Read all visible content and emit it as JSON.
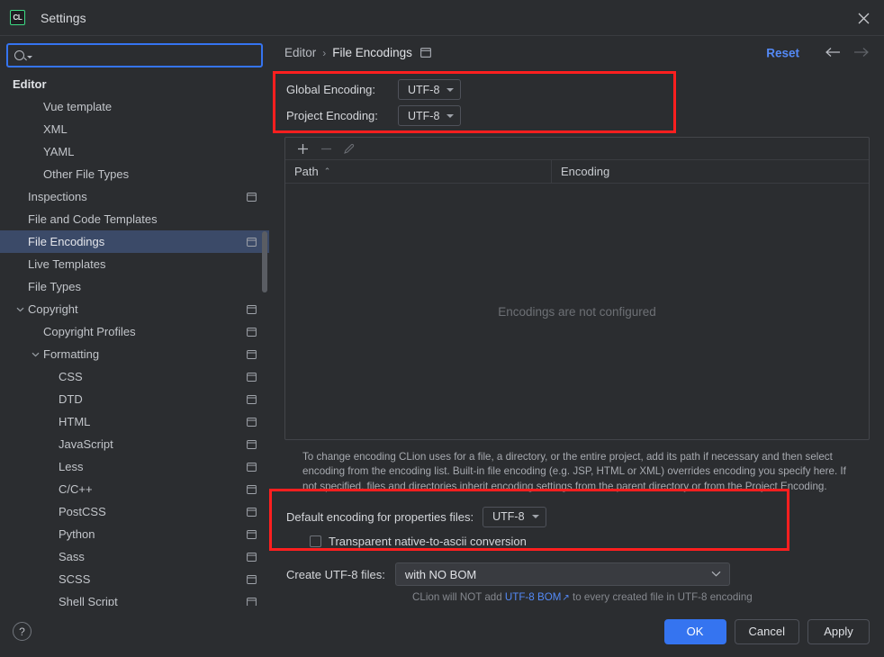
{
  "window": {
    "title": "Settings",
    "logo_text": "CL",
    "close_icon": "close-icon"
  },
  "search": {
    "value": "",
    "placeholder": ""
  },
  "sidebar": {
    "items": [
      {
        "label": "Editor",
        "depth": 0,
        "bold": true,
        "twisty": "",
        "project_icon": false,
        "selected": false
      },
      {
        "label": "Vue template",
        "depth": 2,
        "bold": false,
        "twisty": "",
        "project_icon": false,
        "selected": false
      },
      {
        "label": "XML",
        "depth": 2,
        "bold": false,
        "twisty": "",
        "project_icon": false,
        "selected": false
      },
      {
        "label": "YAML",
        "depth": 2,
        "bold": false,
        "twisty": "",
        "project_icon": false,
        "selected": false
      },
      {
        "label": "Other File Types",
        "depth": 2,
        "bold": false,
        "twisty": "",
        "project_icon": false,
        "selected": false
      },
      {
        "label": "Inspections",
        "depth": 1,
        "bold": false,
        "twisty": "",
        "project_icon": true,
        "selected": false
      },
      {
        "label": "File and Code Templates",
        "depth": 1,
        "bold": false,
        "twisty": "",
        "project_icon": false,
        "selected": false
      },
      {
        "label": "File Encodings",
        "depth": 1,
        "bold": false,
        "twisty": "",
        "project_icon": true,
        "selected": true
      },
      {
        "label": "Live Templates",
        "depth": 1,
        "bold": false,
        "twisty": "",
        "project_icon": false,
        "selected": false
      },
      {
        "label": "File Types",
        "depth": 1,
        "bold": false,
        "twisty": "",
        "project_icon": false,
        "selected": false
      },
      {
        "label": "Copyright",
        "depth": 1,
        "bold": false,
        "twisty": "expanded",
        "project_icon": true,
        "selected": false
      },
      {
        "label": "Copyright Profiles",
        "depth": 2,
        "bold": false,
        "twisty": "",
        "project_icon": true,
        "selected": false
      },
      {
        "label": "Formatting",
        "depth": 2,
        "bold": false,
        "twisty": "expanded",
        "project_icon": true,
        "selected": false
      },
      {
        "label": "CSS",
        "depth": 3,
        "bold": false,
        "twisty": "",
        "project_icon": true,
        "selected": false
      },
      {
        "label": "DTD",
        "depth": 3,
        "bold": false,
        "twisty": "",
        "project_icon": true,
        "selected": false
      },
      {
        "label": "HTML",
        "depth": 3,
        "bold": false,
        "twisty": "",
        "project_icon": true,
        "selected": false
      },
      {
        "label": "JavaScript",
        "depth": 3,
        "bold": false,
        "twisty": "",
        "project_icon": true,
        "selected": false
      },
      {
        "label": "Less",
        "depth": 3,
        "bold": false,
        "twisty": "",
        "project_icon": true,
        "selected": false
      },
      {
        "label": "C/C++",
        "depth": 3,
        "bold": false,
        "twisty": "",
        "project_icon": true,
        "selected": false
      },
      {
        "label": "PostCSS",
        "depth": 3,
        "bold": false,
        "twisty": "",
        "project_icon": true,
        "selected": false
      },
      {
        "label": "Python",
        "depth": 3,
        "bold": false,
        "twisty": "",
        "project_icon": true,
        "selected": false
      },
      {
        "label": "Sass",
        "depth": 3,
        "bold": false,
        "twisty": "",
        "project_icon": true,
        "selected": false
      },
      {
        "label": "SCSS",
        "depth": 3,
        "bold": false,
        "twisty": "",
        "project_icon": true,
        "selected": false
      },
      {
        "label": "Shell Script",
        "depth": 3,
        "bold": false,
        "twisty": "",
        "project_icon": true,
        "selected": false
      }
    ]
  },
  "breadcrumb": {
    "parent": "Editor",
    "separator": "›",
    "current": "File Encodings",
    "icon": "project-settings-icon"
  },
  "header": {
    "reset_label": "Reset",
    "back_icon": "arrow-left-icon",
    "forward_icon": "arrow-right-icon"
  },
  "encodings": {
    "global": {
      "label": "Global Encoding:",
      "value": "UTF-8"
    },
    "project": {
      "label": "Project Encoding:",
      "value": "UTF-8"
    }
  },
  "table": {
    "toolbar": {
      "add_icon": "plus-icon",
      "remove_icon": "minus-icon",
      "edit_icon": "pencil-icon"
    },
    "columns": [
      {
        "label": "Path",
        "sort": "⌃"
      },
      {
        "label": "Encoding",
        "sort": ""
      }
    ],
    "rows": [],
    "empty_message": "Encodings are not configured"
  },
  "help_text": "To change encoding CLion uses for a file, a directory, or the entire project, add its path if necessary and then select encoding from the encoding list. Built-in file encoding (e.g. JSP, HTML or XML) overrides encoding you specify here. If not specified, files and directories inherit encoding settings from the parent directory or from the Project Encoding.",
  "properties": {
    "default_encoding_label": "Default encoding for properties files:",
    "default_encoding_value": "UTF-8",
    "transparent_label": "Transparent native-to-ascii conversion",
    "transparent_checked": false
  },
  "create_utf8": {
    "label": "Create UTF-8 files:",
    "value": "with NO BOM",
    "note_prefix": "CLion will NOT add ",
    "note_link": "UTF-8 BOM",
    "note_ext_icon": "↗",
    "note_suffix": " to every created file in UTF-8 encoding"
  },
  "footer": {
    "help_label": "?",
    "ok_label": "OK",
    "cancel_label": "Cancel",
    "apply_label": "Apply"
  },
  "colors": {
    "accent_blue": "#3574f0",
    "link_blue": "#548af7",
    "selection": "#3b4a68",
    "highlight_red": "#ff1f1f",
    "background": "#2b2d30",
    "logo_green": "#3ddb85"
  }
}
